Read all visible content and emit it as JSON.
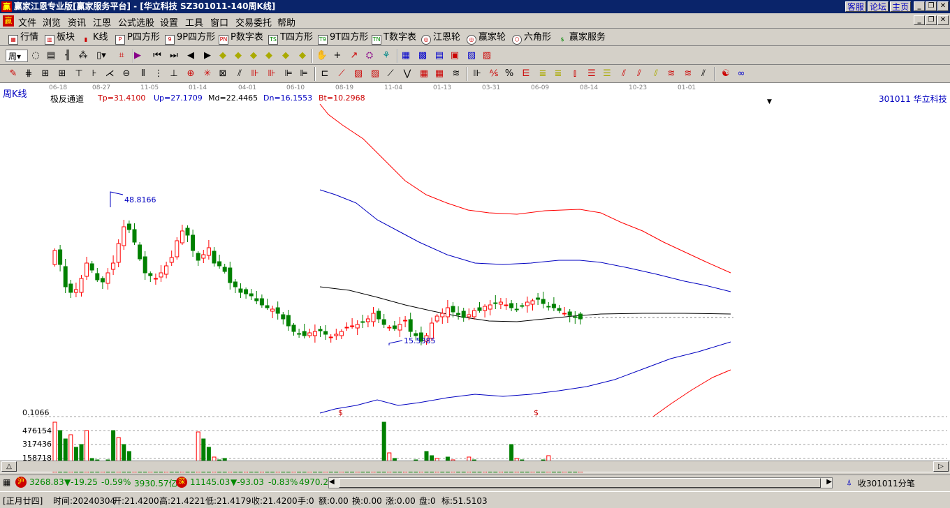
{
  "window": {
    "logo": "赢",
    "title": "赢家江恩专业版[赢家服务平台] - [华立科技   SZ301011-140周K线]",
    "links": [
      "客服",
      "论坛",
      "主页"
    ]
  },
  "menu": [
    "文件",
    "浏览",
    "资讯",
    "江恩",
    "公式选股",
    "设置",
    "工具",
    "窗口",
    "交易委托",
    "帮助"
  ],
  "toolbar1": [
    {
      "label": "行情",
      "icon": "grid-icon"
    },
    {
      "label": "板块",
      "icon": "blocks-icon"
    },
    {
      "label": "K线",
      "icon": "kline-icon"
    },
    {
      "label": "P四方形",
      "icon": "P"
    },
    {
      "label": "9P四方形",
      "icon": "9"
    },
    {
      "label": "P数字表",
      "icon": "PN"
    },
    {
      "label": "T四方形",
      "icon": "TS"
    },
    {
      "label": "9T四方形",
      "icon": "T9"
    },
    {
      "label": "T数字表",
      "icon": "TN"
    },
    {
      "label": "江恩轮",
      "icon": "wheel-icon"
    },
    {
      "label": "赢家轮",
      "icon": "wheel-icon"
    },
    {
      "label": "六角形",
      "icon": "hexagon-icon"
    },
    {
      "label": "赢家服务",
      "icon": "dollar-icon"
    }
  ],
  "period_select": "周",
  "chart": {
    "period_label": "周K线",
    "indicator_name": "极反通道",
    "tp": "Tp=31.4100",
    "up": "Up=27.1709",
    "md": "Md=22.4465",
    "dn": "Dn=16.1553",
    "bt": "Bt=10.2968",
    "stock": "301011  华立科技",
    "date_ticks": [
      "06-18",
      "08-27",
      "11-05",
      "01-14",
      "04-01",
      "06-10",
      "08-19",
      "11-04",
      "01-13",
      "03-31",
      "06-09",
      "08-14",
      "10-23",
      "01-01"
    ],
    "high_label": "48.8166",
    "low_label": "15.5385",
    "marker": "$",
    "vol_scale": [
      "0.1066",
      "476154",
      "317436",
      "158718"
    ],
    "colors": {
      "up": "#ff0000",
      "down": "#008000",
      "channel_outer": "#ff0000",
      "channel_inner": "#0000c0",
      "mid": "#000000"
    }
  },
  "chart_data": {
    "type": "candlestick",
    "title": "华立科技 SZ301011 周K线",
    "ylim": [
      10,
      52
    ],
    "high": 48.8166,
    "low": 15.5385,
    "last": {
      "date": "20240304",
      "open": 21.42,
      "high": 21.4221,
      "low": 21.4179,
      "close": 21.42
    },
    "channel": {
      "Tp": 31.41,
      "Up": 27.1709,
      "Md": 22.4465,
      "Dn": 16.1553,
      "Bt": 10.2968
    }
  },
  "status": {
    "sh_icon": "沪",
    "sh_index": "3268.83",
    "sh_change": "▼-19.25",
    "sh_pct": "-0.59%",
    "sh_amount": "3930.57亿",
    "sz_icon": "深",
    "sz_index": "11145.03",
    "sz_change": "▼-93.03",
    "sz_pct": "-0.83%",
    "sz_amount": "4970.2",
    "tick_label": "收301011分笔"
  },
  "info": {
    "lunar": "[正月廿四]",
    "time": "时间:20240304",
    "open": "开:21.4200",
    "high": "高:21.4221",
    "low": "低:21.4179",
    "close": "收:21.4200",
    "vol": "手:0",
    "amount": "额:0.00",
    "turnover": "换:0.00",
    "change": "涨:0.00",
    "pan": "盘:0",
    "mark": "标:51.5103"
  }
}
